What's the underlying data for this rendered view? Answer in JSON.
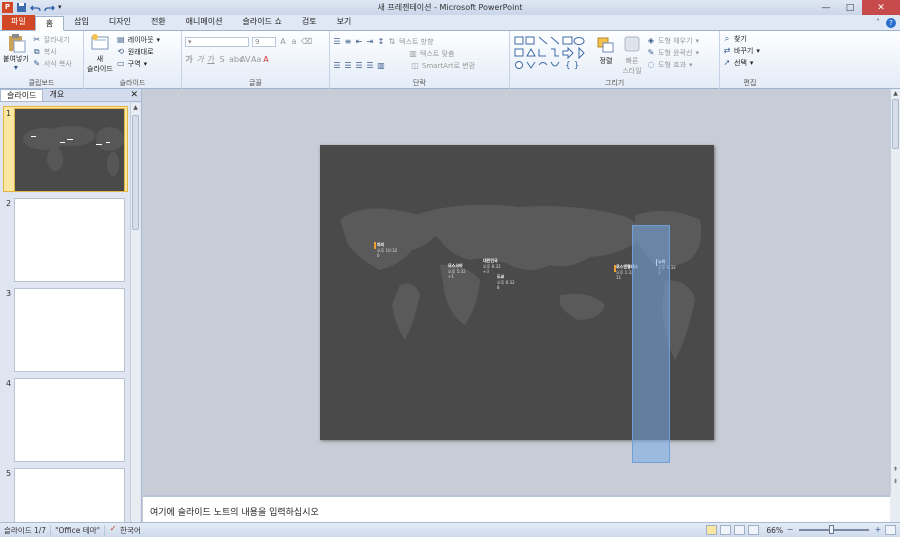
{
  "window": {
    "title": "새 프레젠테이션 - Microsoft PowerPoint"
  },
  "tabs": [
    "파일",
    "홈",
    "삽입",
    "디자인",
    "전환",
    "애니메이션",
    "슬라이드 쇼",
    "검토",
    "보기"
  ],
  "active_tab": "홈",
  "ribbon": {
    "clipboard": {
      "paste": "붙여넣기",
      "cut": "잘라내기",
      "copy": "복사",
      "format_painter": "서식 복사",
      "label": "클립보드"
    },
    "slides": {
      "new_slide": "새\n슬라이드",
      "new_slide_line1": "새",
      "new_slide_line2": "슬라이드",
      "layout": "레이아웃",
      "reset": "원래대로",
      "section": "구역",
      "label": "슬라이드"
    },
    "font": {
      "size": "9",
      "label": "글꼴"
    },
    "paragraph": {
      "text_direction": "텍스트 방향",
      "align_text": "텍스트 맞춤",
      "smartart": "SmartArt로 변환",
      "label": "단락"
    },
    "drawing": {
      "arrange": "정렬",
      "quick_styles_1": "빠른",
      "quick_styles_2": "스타일",
      "shape_fill": "도형 채우기",
      "shape_outline": "도형 윤곽선",
      "shape_effects": "도형 효과",
      "label": "그리기"
    },
    "editing": {
      "find": "찾기",
      "replace": "바꾸기",
      "select": "선택",
      "label": "편집"
    }
  },
  "left_panel": {
    "tabs": [
      "슬라이드",
      "개요"
    ],
    "slide_numbers": [
      "1",
      "2",
      "3",
      "4",
      "5"
    ]
  },
  "slide": {
    "cities": [
      {
        "name": "파리",
        "time": "오후 10:32",
        "offset": "0"
      },
      {
        "name": "모스크바",
        "time": "오후 5:32",
        "offset": "+1"
      },
      {
        "name": "대한민국",
        "time": "오후 6:32",
        "offset": "+3"
      },
      {
        "name": "도쿄",
        "time": "오후 6:32",
        "offset": "8"
      },
      {
        "name": "로스앤젤레스",
        "time": "오후 1:32",
        "offset": "11"
      },
      {
        "name": "뉴욕",
        "time": "오후 4:32",
        "offset": "3"
      }
    ]
  },
  "notes": {
    "placeholder": "여기에 슬라이드 노트의 내용을 입력하십시오"
  },
  "status": {
    "slide": "슬라이드 1/7",
    "theme": "\"Office 테마\"",
    "language": "한국어",
    "zoom": "66%"
  },
  "colors": {
    "file_tab": "#d24726",
    "slide_bg": "#4a4a4a",
    "map": "#5a5a5a",
    "selection": "#78aae6"
  }
}
